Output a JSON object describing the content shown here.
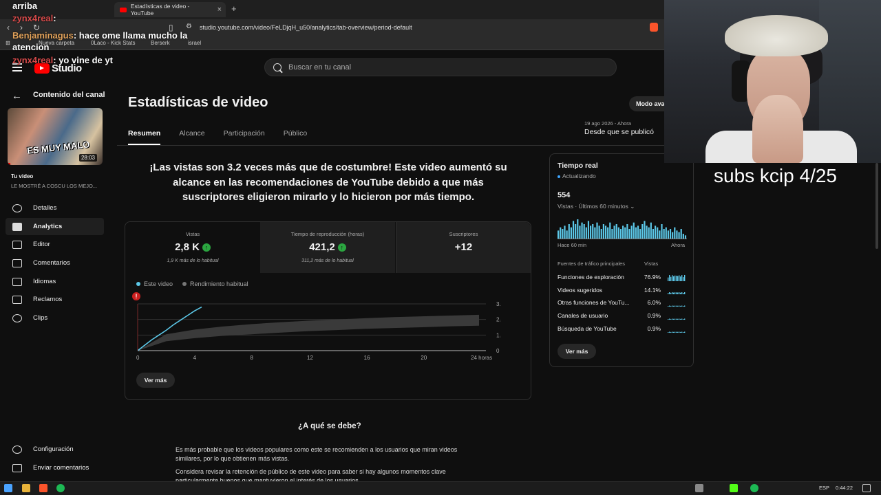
{
  "browser": {
    "tab_title": "Estadísticas de video - YouTube",
    "url": "studio.youtube.com/video/FeLDjqH_u50/analytics/tab-overview/period-default",
    "bookmarks": [
      "Nueva carpeta",
      "0Laco - Kick Stats",
      "Berserk",
      "israel"
    ]
  },
  "chat": [
    {
      "user": "arriba",
      "text": ""
    },
    {
      "user": "zynx4real",
      "text": ":"
    },
    {
      "user": "Benjaminagus",
      "text": ": hace ome llama mucho la"
    },
    {
      "user": "",
      "text": "atencion"
    },
    {
      "user": "zynx4real",
      "text": ": yo vine de yt"
    }
  ],
  "header": {
    "logo_text": "Studio",
    "search_placeholder": "Buscar en tu canal"
  },
  "sidebar": {
    "title": "Contenido del canal",
    "video_duration": "28:03",
    "video_caption": "ES MUY MALO",
    "your_video_label": "Tu video",
    "video_title": "LE MOSTRÉ A COSCU LOS MEJO...",
    "items": [
      {
        "label": "Detalles",
        "icon": "pencil-icon"
      },
      {
        "label": "Analytics",
        "icon": "analytics-icon"
      },
      {
        "label": "Editor",
        "icon": "editor-icon"
      },
      {
        "label": "Comentarios",
        "icon": "comments-icon"
      },
      {
        "label": "Idiomas",
        "icon": "subtitles-icon"
      },
      {
        "label": "Reclamos",
        "icon": "copyright-icon"
      },
      {
        "label": "Clips",
        "icon": "scissors-icon"
      }
    ],
    "bottom": [
      {
        "label": "Configuración",
        "icon": "gear-icon"
      },
      {
        "label": "Enviar comentarios",
        "icon": "feedback-icon"
      }
    ]
  },
  "main": {
    "title": "Estadísticas de video",
    "tabs": [
      "Resumen",
      "Alcance",
      "Participación",
      "Público"
    ],
    "date_range": "19 ago 2026 - Ahora",
    "date_sub": "Desde que se publicó",
    "mode_button": "Modo ava",
    "headline": "¡Las vistas son 3.2 veces más que de costumbre! Este video aumentó su alcance en las recomendaciones de YouTube debido a que más suscriptores eligieron mirarlo y lo hicieron por más tiempo.",
    "kpis": [
      {
        "label": "Vistas",
        "value": "2,8 K",
        "note": "1,9 K más de lo habitual",
        "up": true
      },
      {
        "label": "Tiempo de reproducción (horas)",
        "value": "421,2",
        "note": "311,2 más de lo habitual",
        "up": true
      },
      {
        "label": "Suscriptores",
        "value": "+12",
        "note": "",
        "up": false
      }
    ],
    "legend": [
      "Este video",
      "Rendimiento habitual"
    ],
    "see_more": "Ver más",
    "why_title": "¿A qué se debe?",
    "why_p1": "Es más probable que los videos populares como este se recomienden a los usuarios que miran videos similares, por lo que obtienen más vistas.",
    "why_p2": "Considera revisar la retención de público de este video para saber si hay algunos momentos clave particularmente buenos que mantuvieron el interés de los usuarios."
  },
  "chart_data": {
    "type": "line",
    "x_ticks": [
      "0",
      "4",
      "8",
      "12",
      "16",
      "20",
      "24 horas"
    ],
    "y_ticks": [
      "0",
      "1.000",
      "2.000",
      "3.000"
    ],
    "ylim": [
      0,
      3000
    ],
    "xlim": [
      0,
      24
    ],
    "series": [
      {
        "name": "Este video",
        "color": "#5cc8e8",
        "x": [
          0,
          0.5,
          1,
          1.5,
          2,
          2.5,
          3,
          3.5,
          4,
          4.5
        ],
        "y": [
          0,
          350,
          700,
          1000,
          1300,
          1650,
          1950,
          2250,
          2550,
          2800
        ]
      },
      {
        "name": "Rendimiento habitual",
        "color": "#555555",
        "x": [
          0,
          2,
          4,
          6,
          8,
          10,
          12,
          14,
          16,
          18,
          20,
          22,
          24
        ],
        "y_low": [
          0,
          600,
          800,
          950,
          1050,
          1150,
          1250,
          1320,
          1400,
          1450,
          1500,
          1560,
          1600
        ],
        "y_high": [
          0,
          1050,
          1350,
          1550,
          1700,
          1820,
          1920,
          2000,
          2080,
          2150,
          2200,
          2250,
          2300
        ]
      }
    ]
  },
  "realtime": {
    "title": "Tiempo real",
    "status": "Actualizando",
    "count": "554",
    "period": "Vistas · Últimos 60 minutos",
    "ax_left": "Hace 60 min",
    "ax_right": "Ahora",
    "bars": [
      5,
      7,
      6,
      8,
      5,
      9,
      7,
      11,
      9,
      12,
      8,
      10,
      9,
      7,
      11,
      8,
      9,
      7,
      10,
      8,
      6,
      9,
      8,
      7,
      10,
      6,
      8,
      9,
      7,
      6,
      8,
      7,
      9,
      6,
      8,
      10,
      7,
      8,
      6,
      9,
      11,
      8,
      7,
      10,
      6,
      8,
      7,
      5,
      9,
      6,
      7,
      5,
      6,
      4,
      7,
      5,
      4,
      6,
      3,
      2
    ],
    "sources_header": "Fuentes de tráfico principales",
    "views_header": "Vistas",
    "sources": [
      {
        "name": "Funciones de exploración",
        "pct": "76.9%"
      },
      {
        "name": "Videos sugeridos",
        "pct": "14.1%"
      },
      {
        "name": "Otras funciones de YouTu...",
        "pct": "6.0%"
      },
      {
        "name": "Canales de usuario",
        "pct": "0.9%"
      },
      {
        "name": "Búsqueda de YouTube",
        "pct": "0.9%"
      }
    ],
    "see_more": "Ver más"
  },
  "overlay": {
    "subs_text": "subs kcip 4/25"
  },
  "taskbar": {
    "lang": "ESP",
    "time": "0:44:22"
  },
  "colors": {
    "accent": "#3ea6ff",
    "up": "#2ba640",
    "series": "#5cc8e8",
    "brand_red": "#ff0000"
  }
}
